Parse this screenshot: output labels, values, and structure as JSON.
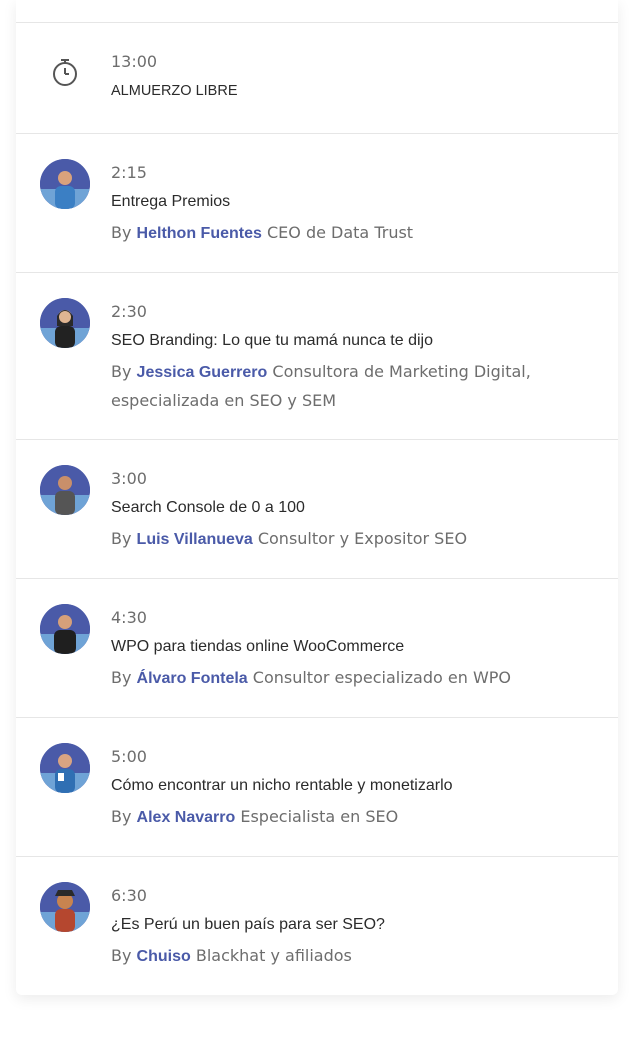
{
  "colors": {
    "accent": "#4a5aa8",
    "border": "#e6e6e6",
    "muted": "#6d6d6d"
  },
  "sessions": [
    {
      "time": "13:00",
      "title": "ALMUERZO LIBRE",
      "icon": "stopwatch-icon"
    },
    {
      "time": "2:15",
      "title": "Entrega Premios",
      "by": "By",
      "speaker": "Helthon Fuentes",
      "role": "CEO de Data Trust"
    },
    {
      "time": "2:30",
      "title": "SEO Branding: Lo que tu mamá nunca te dijo",
      "by": "By",
      "speaker": "Jessica Guerrero",
      "role": "Consultora de Marketing Digital, especializada en SEO y SEM"
    },
    {
      "time": "3:00",
      "title": "Search Console de 0 a 100",
      "by": "By",
      "speaker": "Luis Villanueva",
      "role": "Consultor y Expositor SEO"
    },
    {
      "time": "4:30",
      "title": "WPO para tiendas online WooCommerce",
      "by": "By",
      "speaker": "Álvaro Fontela",
      "role": "Consultor especializado en WPO"
    },
    {
      "time": "5:00",
      "title": "Cómo encontrar un nicho rentable y monetizarlo",
      "by": "By",
      "speaker": "Alex Navarro",
      "role": "Especialista en SEO"
    },
    {
      "time": "6:30",
      "title": "¿Es Perú un buen país para ser SEO?",
      "by": "By",
      "speaker": "Chuiso",
      "role": "Blackhat y afiliados"
    }
  ]
}
